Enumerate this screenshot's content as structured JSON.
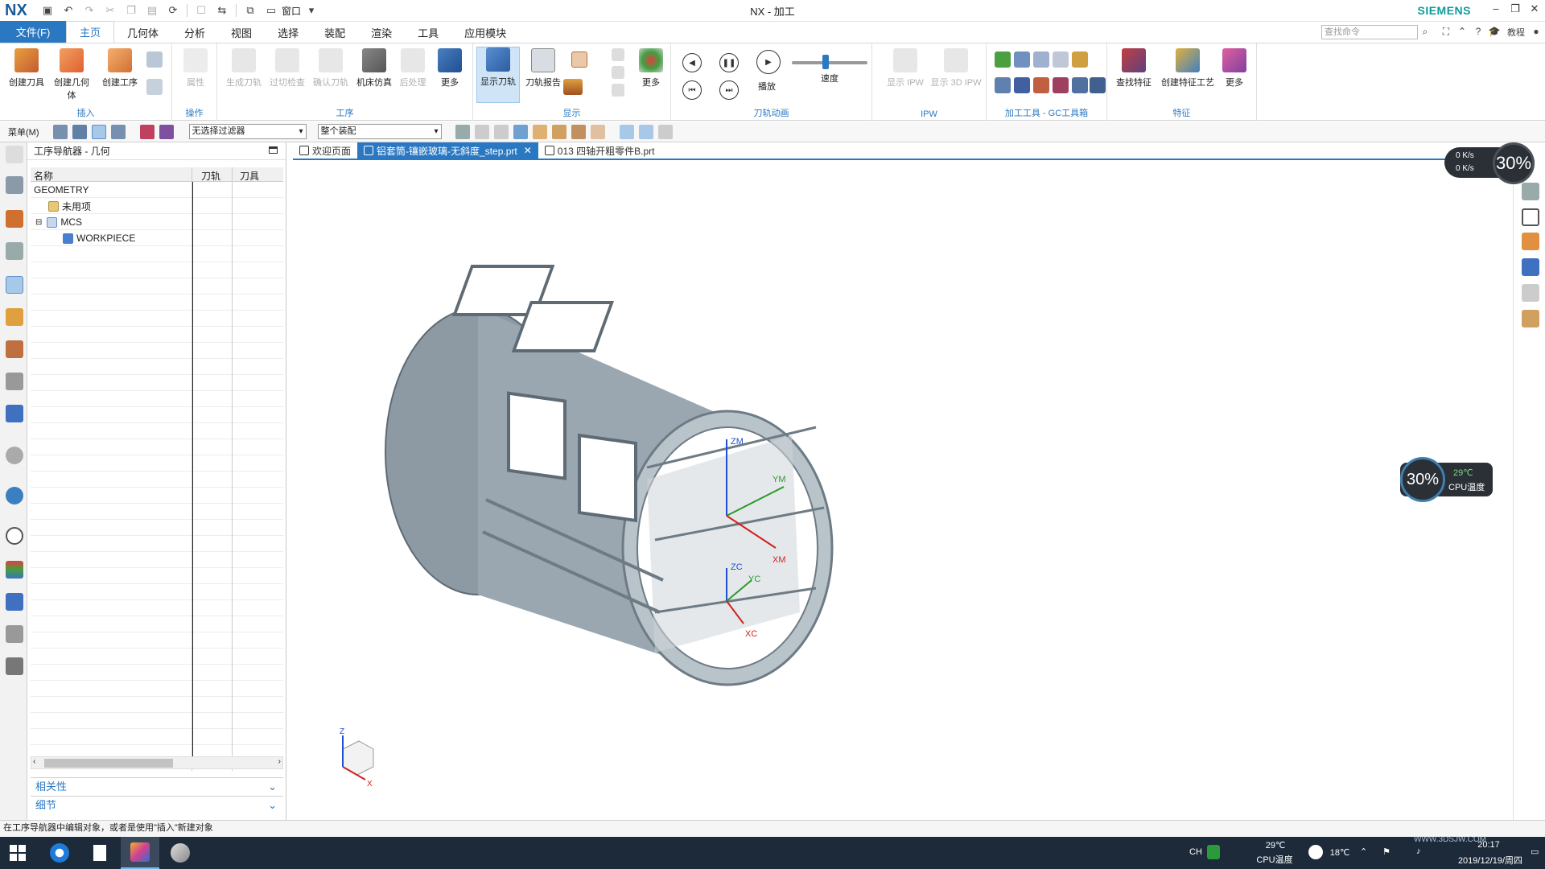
{
  "titlebar": {
    "logo": "NX",
    "title": "NX - 加工",
    "brand": "SIEMENS",
    "window_menu": "窗口"
  },
  "ribbon_tabs": {
    "file": "文件(F)",
    "tabs": [
      "主页",
      "几何体",
      "分析",
      "视图",
      "选择",
      "装配",
      "渲染",
      "工具",
      "应用模块"
    ],
    "search_placeholder": "查找命令",
    "tutorial": "教程"
  },
  "ribbon": {
    "groups": {
      "insert": "插入",
      "operation": "操作",
      "procedure": "工序",
      "display": "显示",
      "toolpath_anim": "刀轨动画",
      "ipw": "IPW",
      "gc_toolbox": "加工工具 - GC工具箱",
      "feature": "特征"
    },
    "buttons": {
      "create_tool": "创建刀具",
      "create_geometry": "创建几何体",
      "create_operation": "创建工序",
      "properties": "属性",
      "generate_toolpath": "生成刀轨",
      "verify_check": "过切检查",
      "confirm_toolpath": "确认刀轨",
      "machine_sim": "机床仿真",
      "postprocess": "后处理",
      "more1": "更多",
      "show_toolpath": "显示刀轨",
      "toolpath_report": "刀轨报告",
      "more2": "更多",
      "play": "播放",
      "speed": "速度",
      "show_ipw": "显示 IPW",
      "show_3d_ipw": "显示 3D IPW",
      "find_feature": "查找特征",
      "create_feature_process": "创建特征工艺",
      "more3": "更多"
    }
  },
  "filterbar": {
    "menu": "菜单(M)",
    "filter_value": "无选择过滤器",
    "assembly_value": "整个装配"
  },
  "navigator": {
    "title": "工序导航器 - 几何",
    "columns": [
      "名称",
      "刀轨",
      "刀具"
    ],
    "rows": [
      {
        "label": "GEOMETRY"
      },
      {
        "label": "未用项"
      },
      {
        "label": "MCS"
      },
      {
        "label": "WORKPIECE"
      }
    ],
    "panels": [
      "相关性",
      "细节"
    ]
  },
  "doc_tabs": [
    {
      "label": "欢迎页面"
    },
    {
      "label": "铝套筒-镶嵌玻璃-无斜度_step.prt"
    },
    {
      "label": "013 四轴开粗零件B.prt"
    }
  ],
  "viewport": {
    "axis_labels": {
      "zm": "ZM",
      "ym": "YM",
      "xm": "XM",
      "zc": "ZC",
      "yc": "YC",
      "xc": "XC"
    },
    "triad": {
      "z": "Z",
      "x": "X"
    }
  },
  "widgets": {
    "net_up": "0 K/s",
    "net_down": "0 K/s",
    "net_percent": "30%",
    "cpu_percent": "30%",
    "cpu_temp": "29℃",
    "cpu_label": "CPU温度"
  },
  "statusbar": {
    "message": "在工序导航器中编辑对象，或者是使用\"插入\"新建对象"
  },
  "taskbar": {
    "ime": "CH",
    "cpu_temp": "29℃",
    "cpu_label": "CPU温度",
    "weather": "18℃",
    "time": "20:17",
    "date": "2019/12/19/周四",
    "watermark": "WWW.3DSJW.COM"
  },
  "colors": {
    "accent": "#2b78c2",
    "brand": "#0f9a9a",
    "model": "#9aa7b0"
  }
}
